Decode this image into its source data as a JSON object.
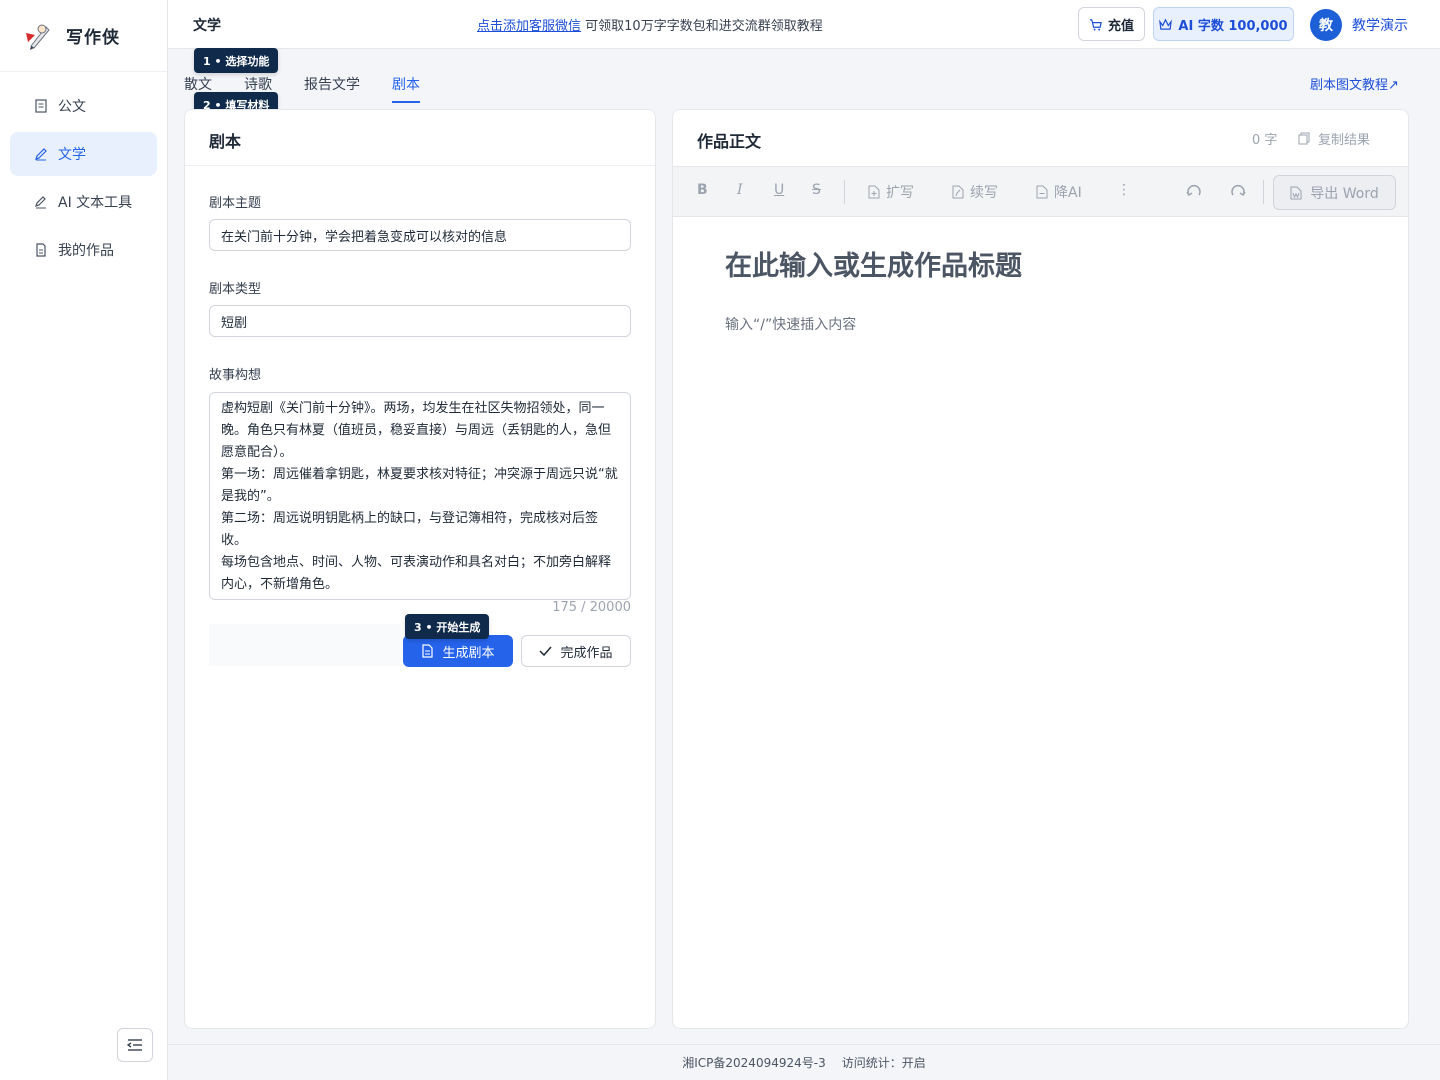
{
  "brand": {
    "name": "写作侠",
    "logo_icon": "pen-mascot-icon"
  },
  "sidebar": {
    "items": [
      {
        "label": "公文",
        "icon": "document-icon"
      },
      {
        "label": "文学",
        "icon": "pen-icon",
        "active": true
      },
      {
        "label": "AI 文本工具",
        "icon": "edit-icon"
      },
      {
        "label": "我的作品",
        "icon": "file-icon"
      }
    ]
  },
  "header": {
    "title": "文学",
    "notice_link": "点击添加客服微信",
    "notice_text": "可领取10万字字数包和进交流群领取教程",
    "recharge_label": "充值",
    "ai_quota_label": "AI 字数 100,000",
    "avatar_char": "教",
    "username": "教学演示"
  },
  "tabs": {
    "items": [
      "散文",
      "诗歌",
      "报告文学",
      "剧本"
    ],
    "active": "剧本",
    "tutorial_link": "剧本图文教程↗"
  },
  "steps": {
    "step1": "1 • 选择功能",
    "step2": "2 • 填写材料",
    "step3": "3 • 开始生成"
  },
  "form": {
    "panel_title": "剧本",
    "theme_label": "剧本主题",
    "theme_value": "在关门前十分钟，学会把着急变成可以核对的信息",
    "type_label": "剧本类型",
    "type_value": "短剧",
    "story_label": "故事构想",
    "story_value": "虚构短剧《关门前十分钟》。两场，均发生在社区失物招领处，同一晚。角色只有林夏（值班员，稳妥直接）与周远（丢钥匙的人，急但愿意配合）。\n第一场：周远催着拿钥匙，林夏要求核对特征；冲突源于周远只说“就是我的”。\n第二场：周远说明钥匙柄上的缺口，与登记簿相符，完成核对后签收。\n每场包含地点、时间、人物、可表演动作和具名对白；不加旁白解释内心，不新增角色。",
    "counter": "175 / 20000",
    "generate_label": "生成剧本",
    "finish_label": "完成作品"
  },
  "editor": {
    "panel_title": "作品正文",
    "word_count": "0 字",
    "copy_label": "复制结果",
    "toolbar": {
      "bold": "B",
      "italic": "I",
      "underline": "U",
      "strike": "S",
      "expand": "扩写",
      "continue": "续写",
      "reduce_ai": "降AI",
      "more": "⋮",
      "export": "导出 Word"
    },
    "title_placeholder": "在此输入或生成作品标题",
    "body_placeholder": "输入“/”快速插入内容"
  },
  "footer": {
    "icp": "湘ICP备2024094924号-3",
    "stats": "访问统计：开启"
  },
  "colors": {
    "accent": "#2563eb",
    "step_badge": "#0f2a4a",
    "active_nav_bg": "#e8f0fd"
  }
}
